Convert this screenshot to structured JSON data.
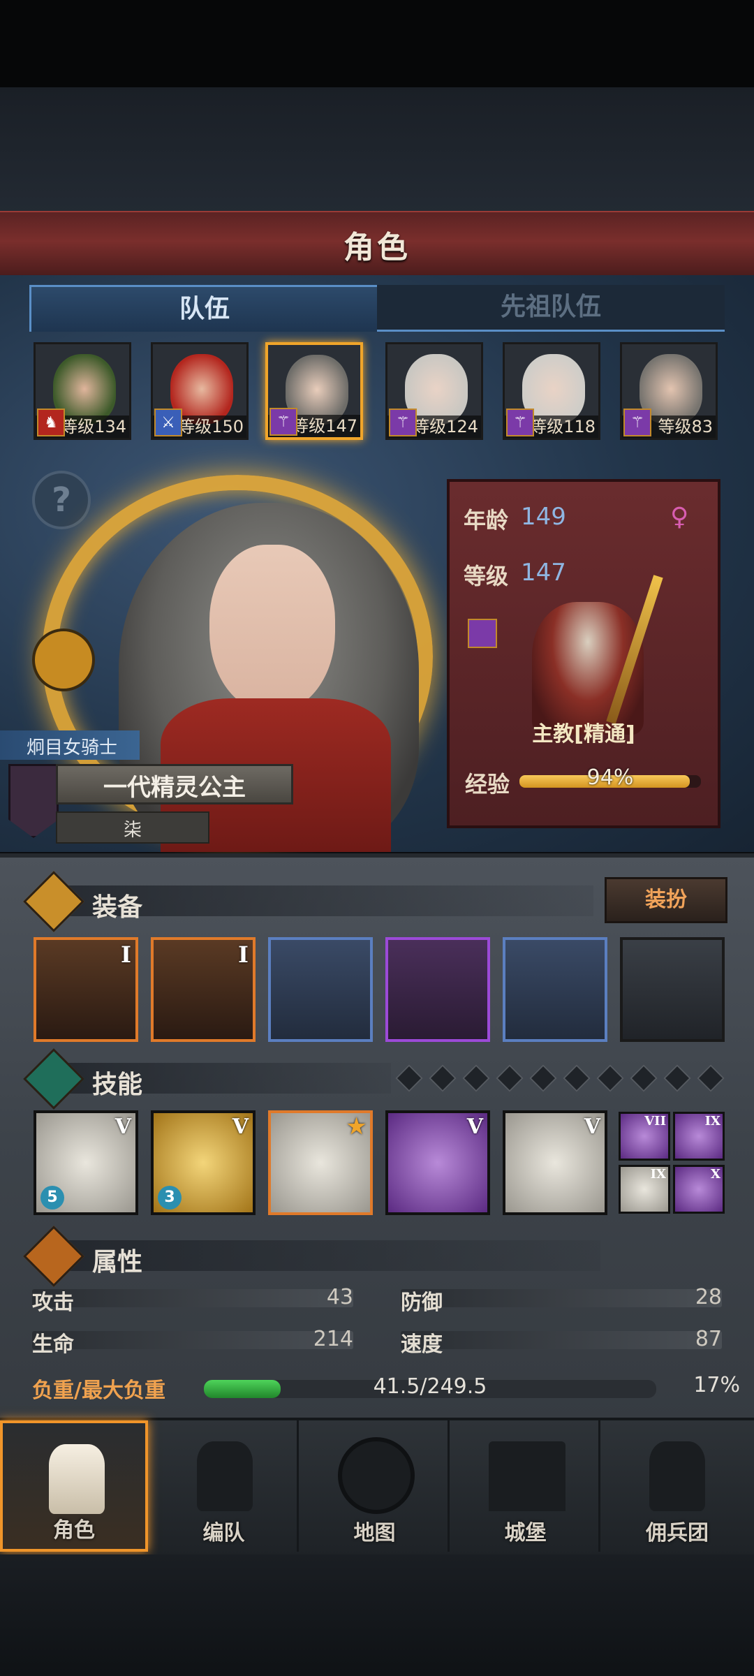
{
  "header": {
    "title": "角色"
  },
  "tabs": [
    {
      "label": "队伍"
    },
    {
      "label": "先祖队伍"
    }
  ],
  "party": [
    {
      "level_text": "等级134",
      "class_color": "#b3261e",
      "icon": "horse-icon"
    },
    {
      "level_text": "等级150",
      "class_color": "#3a5fb8",
      "icon": "sword-icon"
    },
    {
      "level_text": "等级147",
      "class_color": "#7b3aa8",
      "icon": "staff-icon",
      "selected": true
    },
    {
      "level_text": "等级124",
      "class_color": "#7b3aa8",
      "icon": "staff-icon"
    },
    {
      "level_text": "等级118",
      "class_color": "#7b3aa8",
      "icon": "staff-icon"
    },
    {
      "level_text": "等级83",
      "class_color": "#7b3aa8",
      "icon": "staff-icon"
    }
  ],
  "hero": {
    "subtitle": "炯目女骑士",
    "name": "一代精灵公主",
    "sub": "柒"
  },
  "info": {
    "age_label": "年龄",
    "age_value": "149",
    "level_label": "等级",
    "level_value": "147",
    "class_name": "主教[精通]",
    "xp_label": "经验",
    "xp_percent_text": "94%",
    "xp_fraction": 0.94
  },
  "equipment": {
    "title": "装备",
    "dress_button": "装扮",
    "slots": [
      {
        "roman": "I",
        "quality": "orange"
      },
      {
        "roman": "I",
        "quality": "orange"
      },
      {
        "roman": "",
        "quality": "blue"
      },
      {
        "roman": "",
        "quality": "purple"
      },
      {
        "roman": "",
        "quality": "blue"
      },
      {
        "roman": "",
        "quality": "dark"
      }
    ]
  },
  "skills": {
    "title": "技能",
    "slot_dots": 10,
    "items": [
      {
        "roman": "V",
        "style": "gray",
        "count": "5"
      },
      {
        "roman": "V",
        "style": "gold",
        "count": "3"
      },
      {
        "roman": "",
        "style": "orange",
        "count": ""
      },
      {
        "roman": "V",
        "style": "purple",
        "count": ""
      },
      {
        "roman": "V",
        "style": "gray",
        "count": ""
      }
    ],
    "mini": [
      {
        "roman": "VII",
        "style": "purple"
      },
      {
        "roman": "IX",
        "style": "purple"
      },
      {
        "roman": "IX",
        "style": "gray"
      },
      {
        "roman": "X",
        "style": "purple"
      }
    ]
  },
  "attributes": {
    "title": "属性",
    "attack_label": "攻击",
    "attack_value": "43",
    "defense_label": "防御",
    "defense_value": "28",
    "hp_label": "生命",
    "hp_value": "214",
    "speed_label": "速度",
    "speed_value": "87",
    "load_label": "负重/最大负重",
    "load_value": "41.5/249.5",
    "load_percent": "17%",
    "load_fraction": 0.17
  },
  "nav": [
    {
      "label": "角色",
      "active": true
    },
    {
      "label": "编队"
    },
    {
      "label": "地图"
    },
    {
      "label": "城堡"
    },
    {
      "label": "佣兵团"
    }
  ]
}
